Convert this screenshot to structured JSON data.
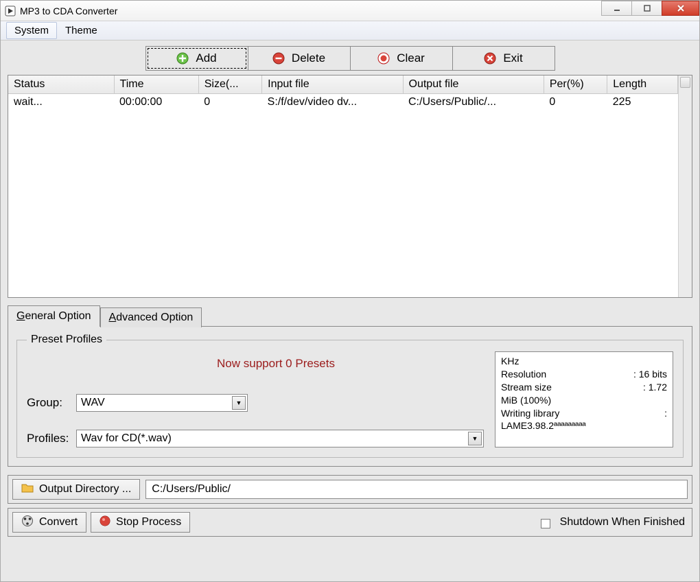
{
  "title": "MP3 to CDA Converter",
  "menus": {
    "system": "System",
    "theme": "Theme"
  },
  "toolbar": {
    "add": "Add",
    "delete": "Delete",
    "clear": "Clear",
    "exit": "Exit"
  },
  "columns": {
    "status": "Status",
    "time": "Time",
    "size": "Size(...",
    "input": "Input file",
    "output": "Output file",
    "per": "Per(%)",
    "length": "Length"
  },
  "rows": [
    {
      "status": "wait...",
      "time": "00:00:00",
      "size": "0",
      "input": "S:/f/dev/video dv...",
      "output": "C:/Users/Public/...",
      "per": "0",
      "length": "225"
    }
  ],
  "tabs": {
    "general": "General Option",
    "advanced": "Advanced Option"
  },
  "preset": {
    "legend": "Preset Profiles",
    "msg": "Now support 0 Presets",
    "group_label": "Group:",
    "group_value": "WAV",
    "profiles_label": "Profiles:",
    "profiles_value": "Wav for CD(*.wav)"
  },
  "info": {
    "l1": "KHz",
    "l2k": "Resolution",
    "l2v": ": 16 bits",
    "l3k": "Stream size",
    "l3v": ": 1.72",
    "l4": "MiB (100%)",
    "l5k": "Writing library",
    "l5v": ":",
    "l6": "LAME3.98.2ªªªªªªªªª"
  },
  "output_dir": {
    "btn": "Output Directory ...",
    "value": "C:/Users/Public/"
  },
  "actions": {
    "convert": "Convert",
    "stop": "Stop Process",
    "shutdown": "Shutdown When Finished"
  }
}
